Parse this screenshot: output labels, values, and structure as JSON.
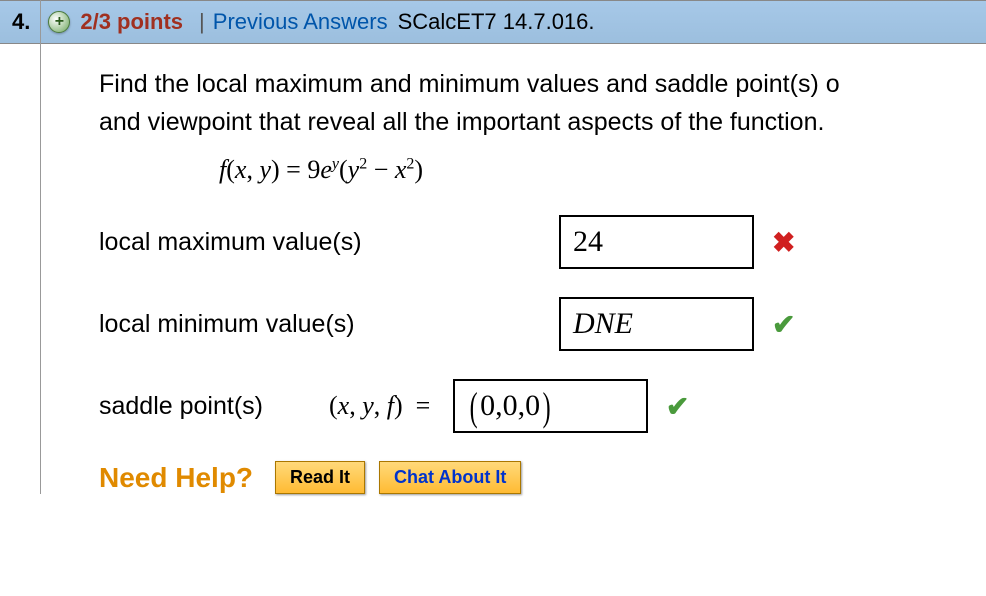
{
  "header": {
    "question_number": "4.",
    "points": "2/3 points",
    "separator": "|",
    "prev_answers_label": "Previous Answers",
    "assignment_code": "SCalcET7 14.7.016."
  },
  "question": {
    "prompt_line1": "Find the local maximum and minimum values and saddle point(s) o",
    "prompt_line2": "and viewpoint that reveal all the important aspects of the function.",
    "equation_html": "f(x, y) = 9e^y(y² − x²)"
  },
  "rows": {
    "local_max": {
      "label": "local maximum value(s)",
      "value": "24",
      "correct": false
    },
    "local_min": {
      "label": "local minimum value(s)",
      "value": "DNE",
      "italic": true,
      "correct": true
    },
    "saddle": {
      "label": "saddle point(s)",
      "prefix": "(x, y, f)  =",
      "value": "(0,0,0)",
      "correct": true
    }
  },
  "help": {
    "label": "Need Help?",
    "read_it": "Read It",
    "chat": "Chat About It"
  }
}
